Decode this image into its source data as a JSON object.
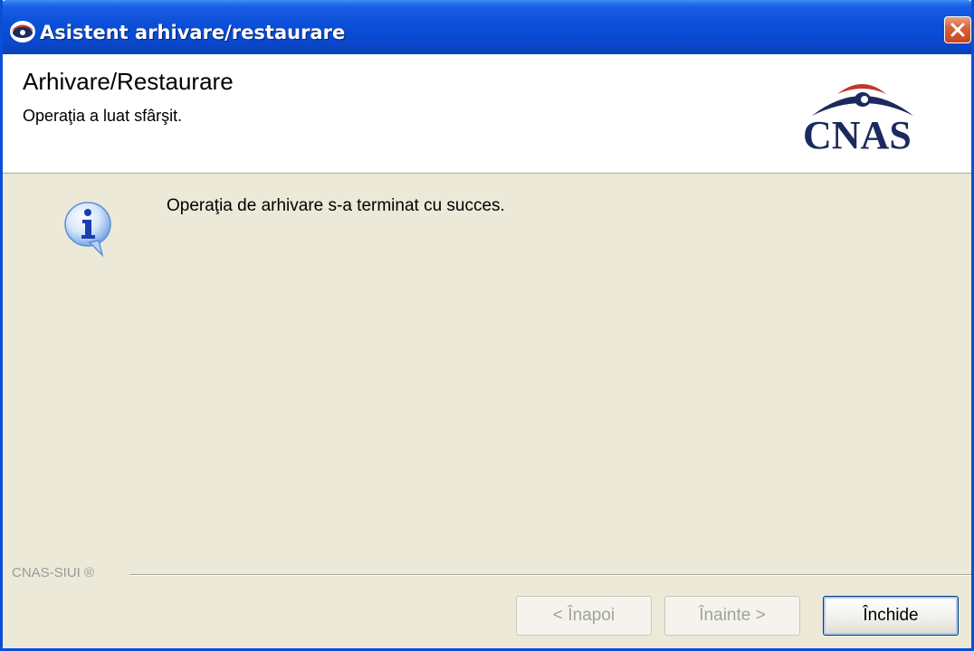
{
  "window": {
    "title": "Asistent arhivare/restaurare"
  },
  "header": {
    "title": "Arhivare/Restaurare",
    "subtitle": "Operaţia a luat sfârşit.",
    "logo_text": "CNAS"
  },
  "content": {
    "message": "Operaţia de arhivare s-a terminat cu succes."
  },
  "footer": {
    "brand": "CNAS-SIUI ®",
    "buttons": {
      "back_label": "< Înapoi",
      "next_label": "Înainte >",
      "close_label": "Închide"
    }
  },
  "colors": {
    "titlebar": "#0a4fd6",
    "dialog_bg": "#ece9d8",
    "logo": "#1b2a5e",
    "logo_accent": "#c0392b"
  },
  "icons": {
    "app": "eye-icon",
    "close": "close-icon",
    "info": "info-icon"
  }
}
